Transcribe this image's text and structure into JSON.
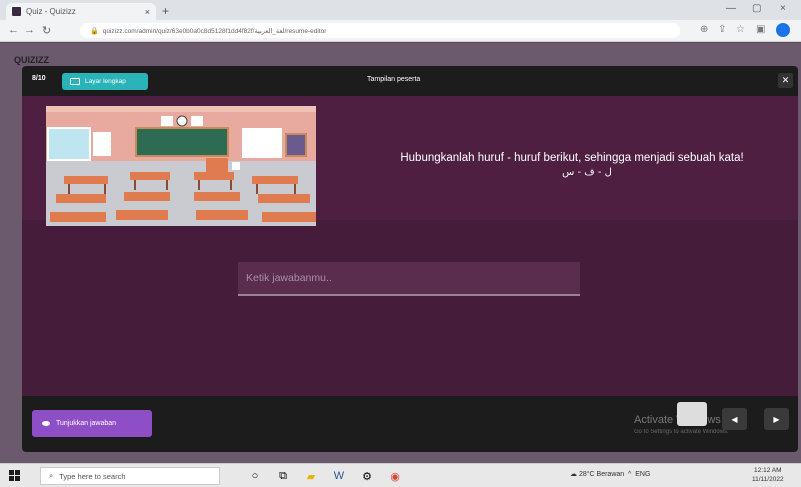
{
  "browser": {
    "tab_title": "Quiz - Quizizz",
    "tab_close": "×",
    "new_tab": "+",
    "url": "quizizz.com/admin/quiz/63e0b0a0c8d5128f1dd4f82f/لغة_العربية/resume-editor",
    "window_controls": [
      "—",
      "▢",
      "×"
    ]
  },
  "background": {
    "logo": "QUIZIZZ"
  },
  "modal": {
    "question_count": "8/10",
    "fullscreen_label": "Layar lengkap",
    "preview_title": "Tampilan peserta",
    "close": "✕",
    "question_text": "Hubungkanlah huruf - huruf berikut, sehingga menjadi sebuah kata!",
    "arabic_letters": "ل - ف - س",
    "answer_placeholder": "Ketik jawabanmu..",
    "show_answer_label": "Tunjukkan jawaban",
    "nav_prev": "◀",
    "nav_next": "▶"
  },
  "watermark": {
    "title": "Activate Windows",
    "subtitle": "Go to Settings to activate Windows."
  },
  "taskbar": {
    "search_placeholder": "Type here to search",
    "weather": "28°C  Berawan",
    "language": "ENG",
    "time": "12:12 AM",
    "date": "11/11/2022"
  },
  "colors": {
    "accent_teal": "#2ab3b8",
    "accent_purple": "#8e4ec6",
    "question_bg": "#4f1f42",
    "content_bg": "#461c3b",
    "modal_bg": "#1c1c1c"
  }
}
